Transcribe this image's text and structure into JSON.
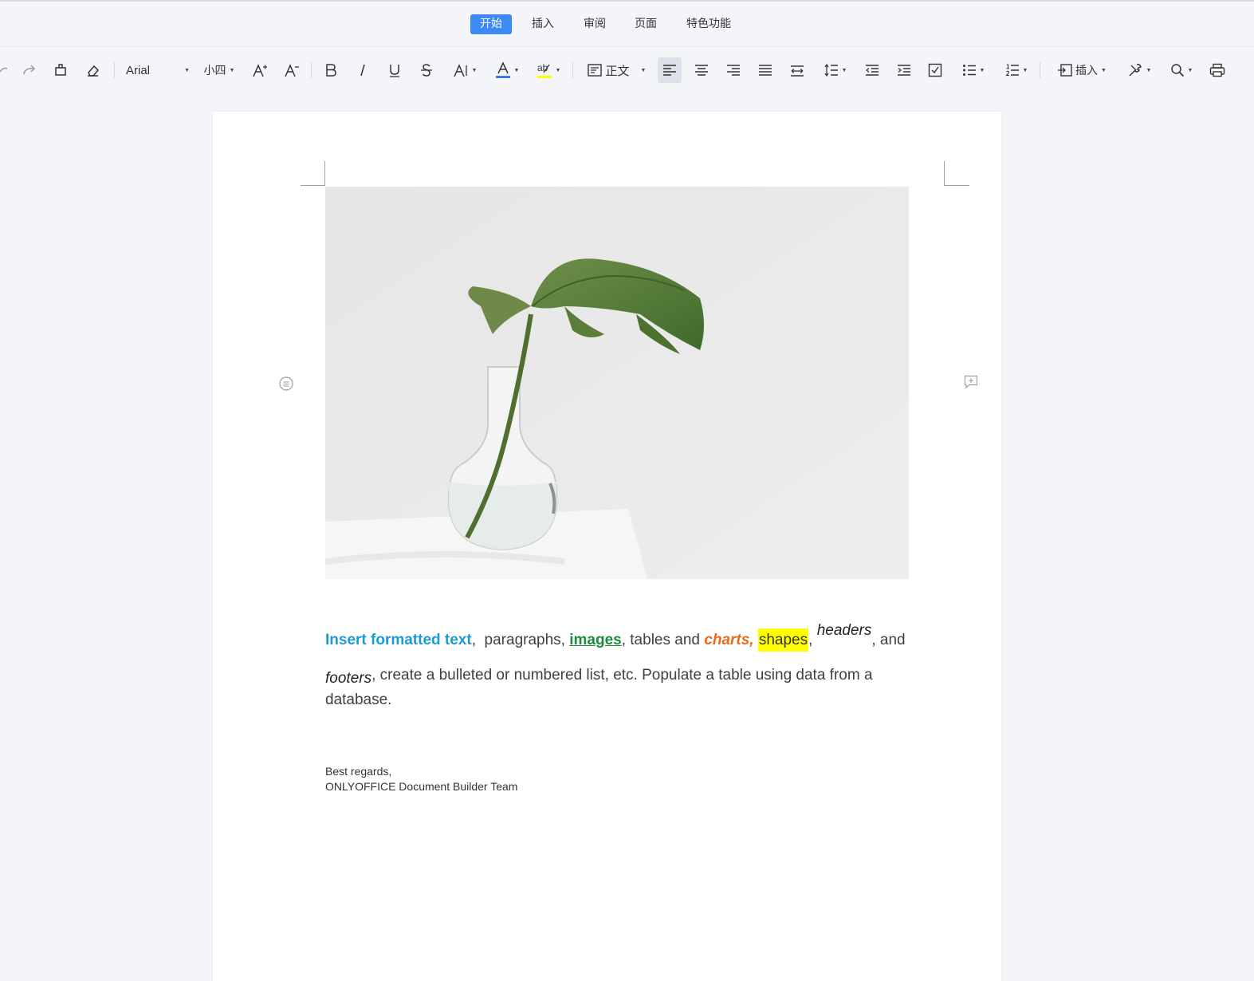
{
  "menu": {
    "tabs": [
      {
        "label": "开始",
        "active": true
      },
      {
        "label": "插入",
        "active": false
      },
      {
        "label": "审阅",
        "active": false
      },
      {
        "label": "页面",
        "active": false
      },
      {
        "label": "特色功能",
        "active": false
      }
    ]
  },
  "toolbar": {
    "font_name": "Arial",
    "font_size": "小四",
    "paragraph_style": "正文",
    "insert_label": "插入",
    "icons": [
      "undo-icon",
      "redo-icon",
      "format-painter-icon",
      "clear-format-icon",
      "increase-font-icon",
      "decrease-font-icon",
      "bold-icon",
      "italic-icon",
      "underline-icon",
      "strikethrough-icon",
      "text-effects-icon",
      "font-color-icon",
      "highlight-icon",
      "paragraph-style-icon",
      "align-left-icon",
      "align-center-icon",
      "align-right-icon",
      "justify-icon",
      "distributed-icon",
      "line-spacing-icon",
      "decrease-indent-icon",
      "increase-indent-icon",
      "checklist-icon",
      "bulleted-list-icon",
      "numbered-list-icon",
      "insert-icon",
      "tools-icon",
      "find-icon",
      "print-icon"
    ],
    "colors": {
      "font_color": "#3b7ddd",
      "highlight_color": "#ffff00",
      "accent": "#3b8af5"
    }
  },
  "document": {
    "image_alt": "plant-in-vase-photo",
    "paragraph": {
      "formatted_text": "Insert formatted text",
      "sep1": ",  paragraphs, ",
      "images": "images",
      "sep2": ", tables and ",
      "charts": "charts,",
      "sep3": " ",
      "shapes": "shapes",
      "sep4": ", ",
      "headers": "headers",
      "sep5": ", and",
      "footers": "footers",
      "rest_line2": ", create a bulleted or numbered list, etc. Populate a table using data from a",
      "line3": "database."
    },
    "signature": {
      "line1": "Best regards,",
      "line2": "ONLYOFFICE Document Builder Team"
    },
    "colors": {
      "blue": "#1d9ad6",
      "green": "#1a8a3f",
      "orange": "#e86c1a",
      "highlight": "#ffff00"
    }
  }
}
